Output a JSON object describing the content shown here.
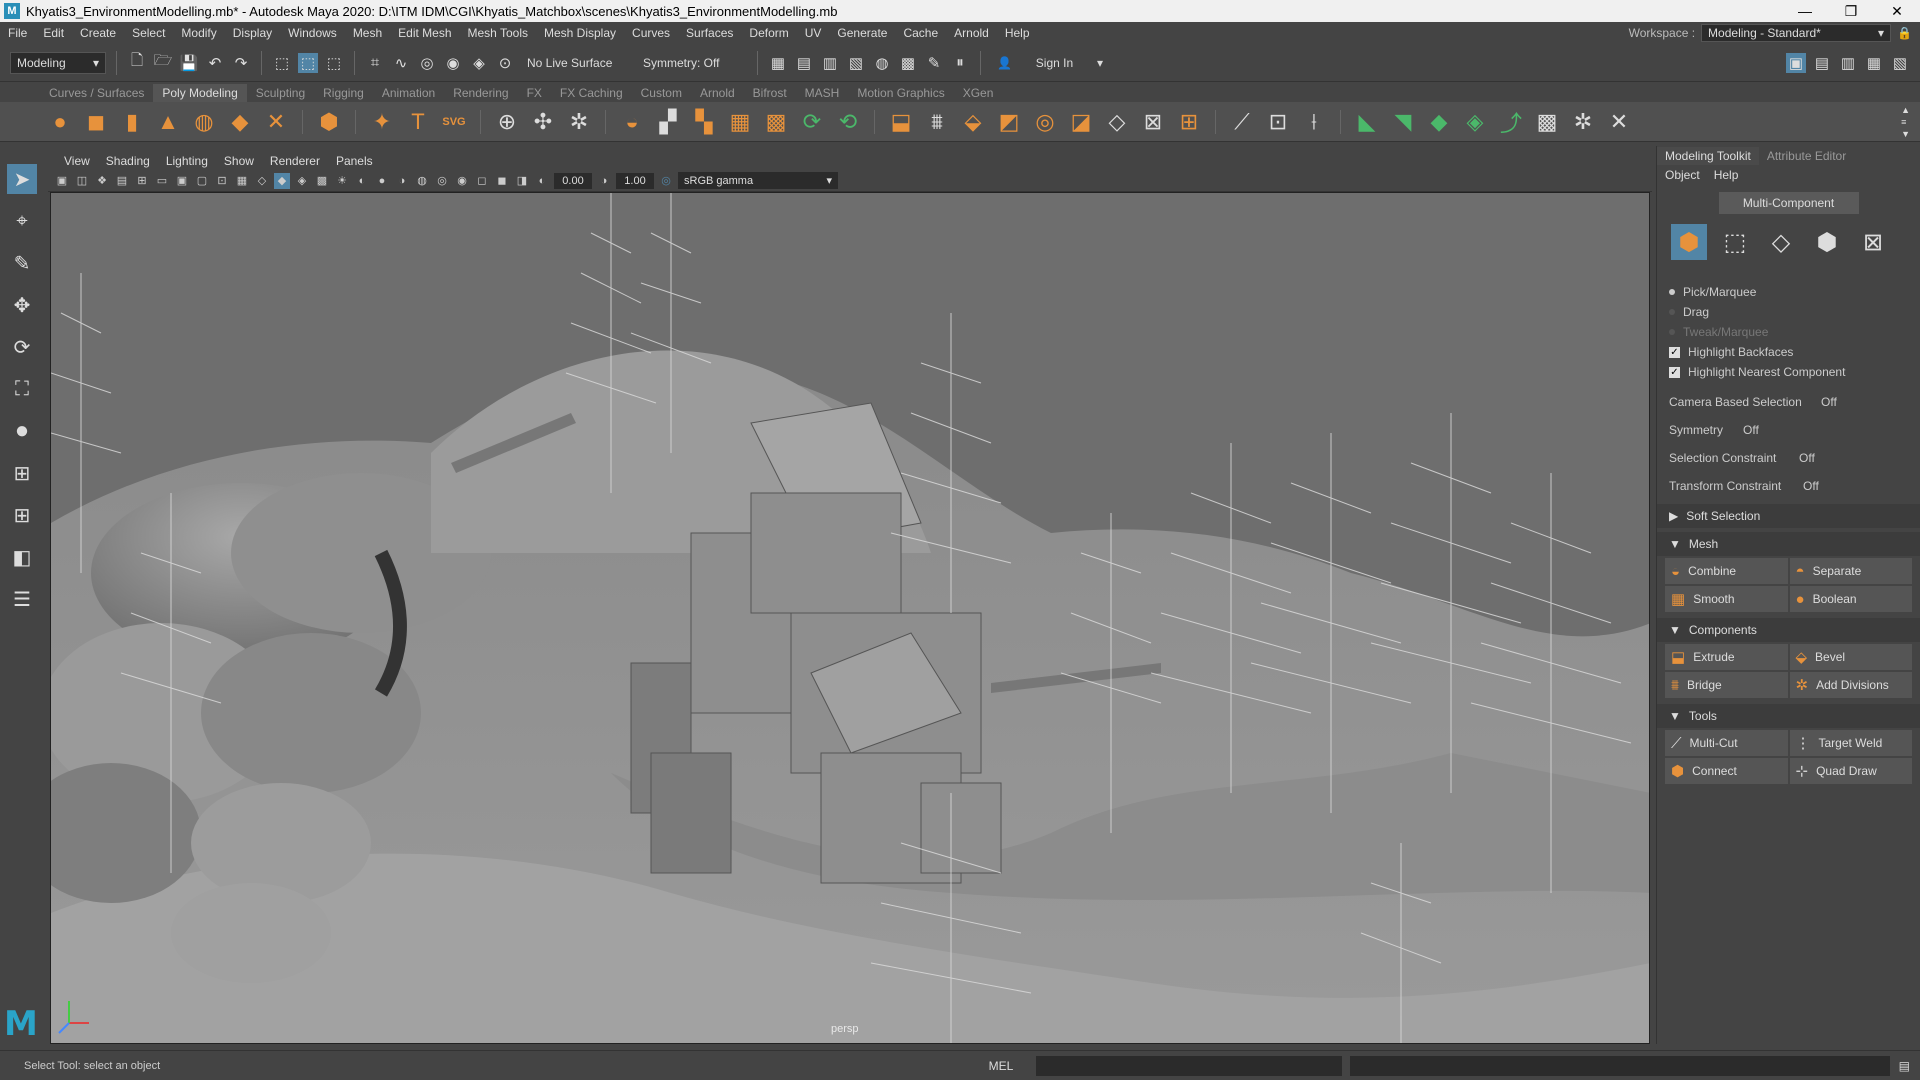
{
  "window": {
    "title": "Khyatis3_EnvironmentModelling.mb* - Autodesk Maya 2020: D:\\ITM IDM\\CGI\\Khyatis_Matchbox\\scenes\\Khyatis3_EnvironmentModelling.mb",
    "app_icon": "M"
  },
  "menubar": {
    "items": [
      "File",
      "Edit",
      "Create",
      "Select",
      "Modify",
      "Display",
      "Windows",
      "Mesh",
      "Edit Mesh",
      "Mesh Tools",
      "Mesh Display",
      "Curves",
      "Surfaces",
      "Deform",
      "UV",
      "Generate",
      "Cache",
      "Arnold",
      "Help"
    ],
    "workspace_label": "Workspace :",
    "workspace_value": "Modeling - Standard*"
  },
  "statusline": {
    "menuset": "Modeling",
    "live_surface": "No Live Surface",
    "symmetry": "Symmetry: Off",
    "sign_in": "Sign In"
  },
  "shelf": {
    "tabs": [
      "Curves / Surfaces",
      "Poly Modeling",
      "Sculpting",
      "Rigging",
      "Animation",
      "Rendering",
      "FX",
      "FX Caching",
      "Custom",
      "Arnold",
      "Bifrost",
      "MASH",
      "Motion Graphics",
      "XGen"
    ],
    "active_tab": "Poly Modeling",
    "text_icons": {
      "type": "T",
      "svg": "SVG"
    }
  },
  "viewport": {
    "menus": [
      "View",
      "Shading",
      "Lighting",
      "Show",
      "Renderer",
      "Panels"
    ],
    "exposure": "0.00",
    "gamma_value": "1.00",
    "color_space": "sRGB gamma",
    "camera": "persp"
  },
  "modeling_toolkit": {
    "tabs": [
      "Modeling Toolkit",
      "Attribute Editor"
    ],
    "submenus": [
      "Object",
      "Help"
    ],
    "multi_component": "Multi-Component",
    "selection_modes": [
      "Pick/Marquee",
      "Drag",
      "Tweak/Marquee"
    ],
    "checks": [
      "Highlight Backfaces",
      "Highlight Nearest Component"
    ],
    "props": [
      {
        "label": "Camera Based Selection",
        "value": "Off"
      },
      {
        "label": "Symmetry",
        "value": "Off"
      },
      {
        "label": "Selection Constraint",
        "value": "Off"
      },
      {
        "label": "Transform Constraint",
        "value": "Off"
      }
    ],
    "soft_selection": "Soft Selection",
    "sections": {
      "mesh": {
        "title": "Mesh",
        "buttons": [
          "Combine",
          "Separate",
          "Smooth",
          "Boolean"
        ]
      },
      "components": {
        "title": "Components",
        "buttons": [
          "Extrude",
          "Bevel",
          "Bridge",
          "Add Divisions"
        ]
      },
      "tools": {
        "title": "Tools",
        "buttons": [
          "Multi-Cut",
          "Target Weld",
          "Connect",
          "Quad Draw"
        ]
      }
    }
  },
  "bottom": {
    "help_line": "Select Tool: select an object",
    "mel_label": "MEL"
  },
  "colors": {
    "accent_blue": "#5285a6",
    "shelf_orange": "#e7923c",
    "shelf_green": "#4bb86a",
    "maya_logo": "#2aa4c8"
  }
}
